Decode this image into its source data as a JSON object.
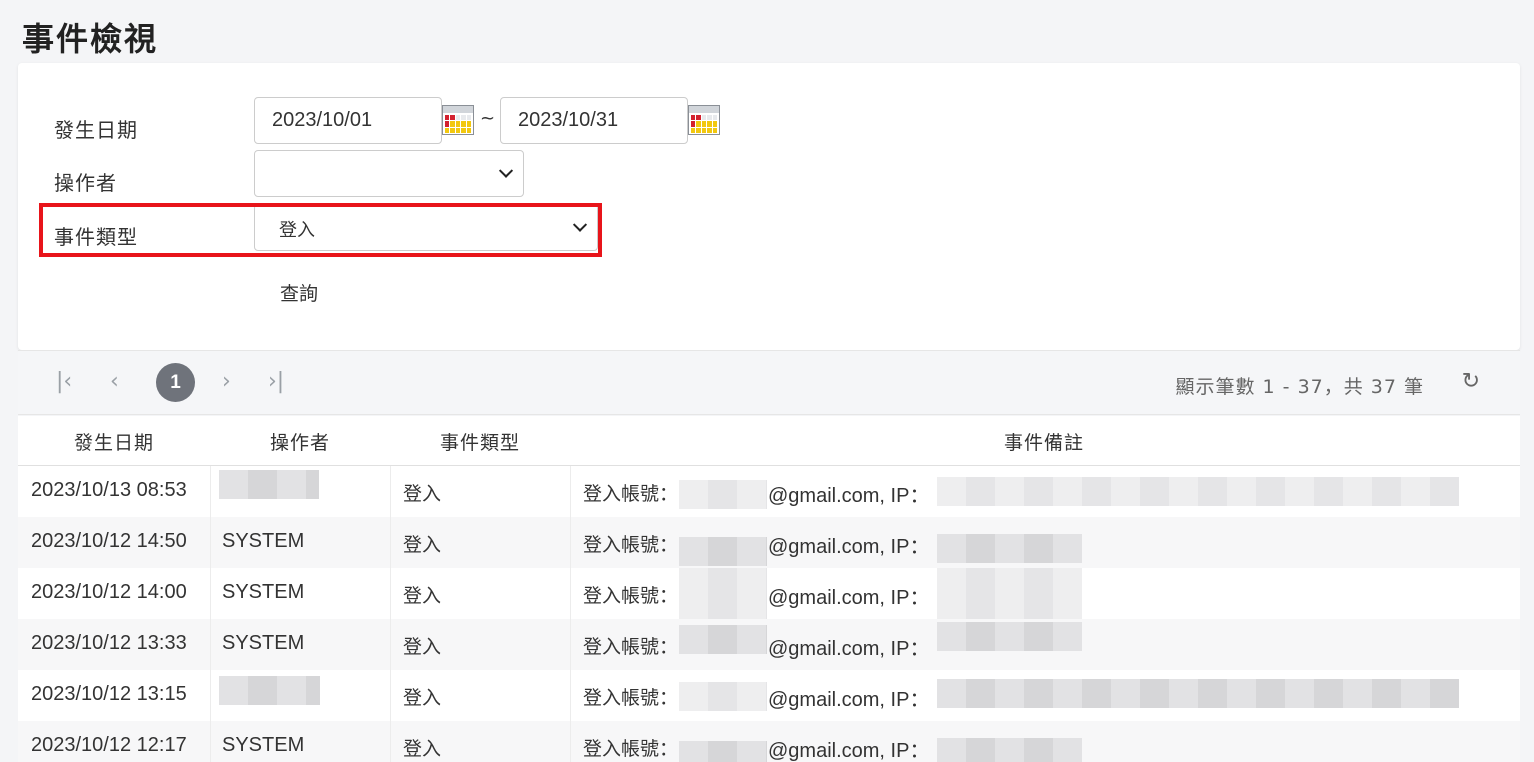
{
  "page": {
    "title": "事件檢視"
  },
  "filters": {
    "date_label": "發生日期",
    "date_from": "2023/10/01",
    "date_separator": "~",
    "date_to": "2023/10/31",
    "operator_label": "操作者",
    "operator_value": "",
    "event_type_label": "事件類型",
    "event_type_value": "登入",
    "query_label": "查詢",
    "highlight_color": "#e8141a"
  },
  "pager": {
    "first_icon": "first-page-icon",
    "prev_icon": "prev-page-icon",
    "current_page": "1",
    "next_icon": "next-page-icon",
    "last_icon": "last-page-icon",
    "info": "顯示筆數 1 - 37，共 37 筆",
    "refresh_icon": "refresh-icon"
  },
  "table": {
    "columns": [
      "發生日期",
      "操作者",
      "事件類型",
      "事件備註"
    ],
    "rows": [
      {
        "date": "2023/10/13 08:53",
        "operator": "",
        "type": "登入",
        "note_prefix": "登入帳號：",
        "note_mid": "@gmail.com, IP："
      },
      {
        "date": "2023/10/12 14:50",
        "operator": "SYSTEM",
        "type": "登入",
        "note_prefix": "登入帳號：",
        "note_mid": "@gmail.com, IP："
      },
      {
        "date": "2023/10/12 14:00",
        "operator": "SYSTEM",
        "type": "登入",
        "note_prefix": "登入帳號：",
        "note_mid": "@gmail.com, IP："
      },
      {
        "date": "2023/10/12 13:33",
        "operator": "SYSTEM",
        "type": "登入",
        "note_prefix": "登入帳號：",
        "note_mid": "@gmail.com, IP："
      },
      {
        "date": "2023/10/12 13:15",
        "operator": "",
        "type": "登入",
        "note_prefix": "登入帳號：",
        "note_mid": "@gmail.com, IP："
      },
      {
        "date": "2023/10/12 12:17",
        "operator": "SYSTEM",
        "type": "登入",
        "note_prefix": "登入帳號：",
        "note_mid": "@gmail.com, IP："
      }
    ]
  }
}
